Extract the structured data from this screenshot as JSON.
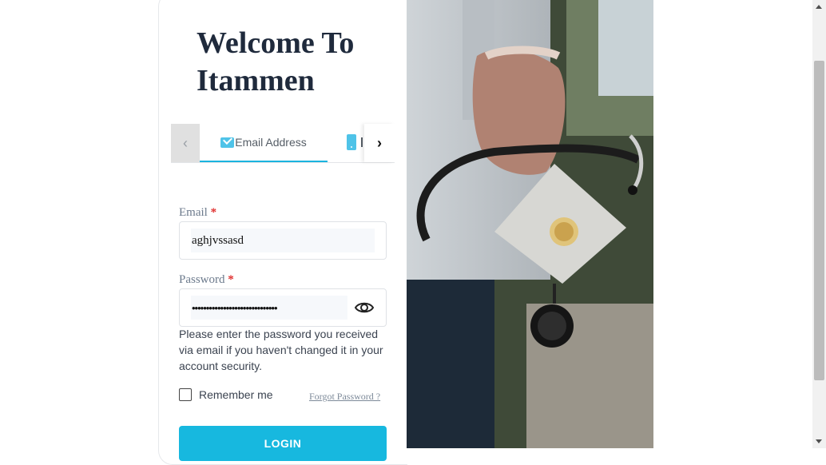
{
  "header": {
    "title": "Welcome To Itammen"
  },
  "tabs": {
    "items": [
      {
        "label": "Email Address",
        "icon": "envelope-icon",
        "active": true
      },
      {
        "label": "Phone",
        "icon": "phone-icon",
        "active": false
      }
    ],
    "prev_icon": "chevron-left-icon",
    "next_icon": "chevron-right-icon"
  },
  "form": {
    "email": {
      "label": "Email",
      "required_mark": "*",
      "value": "aghjvssasd"
    },
    "password": {
      "label": "Password",
      "required_mark": "*",
      "value": "••••••••••••••••••••••••••••••"
    },
    "hint": "Please enter the password you received via email if you haven't changed it in your account security.",
    "remember_label": "Remember me",
    "remember_checked": false,
    "forgot_label": "Forgot Password ?",
    "login_label": "LOGIN"
  },
  "colors": {
    "accent": "#17b8df",
    "title": "#1f2a3c",
    "required": "#e0302f"
  },
  "image": {
    "icon": "doctor-stethoscope-mask-photo"
  }
}
